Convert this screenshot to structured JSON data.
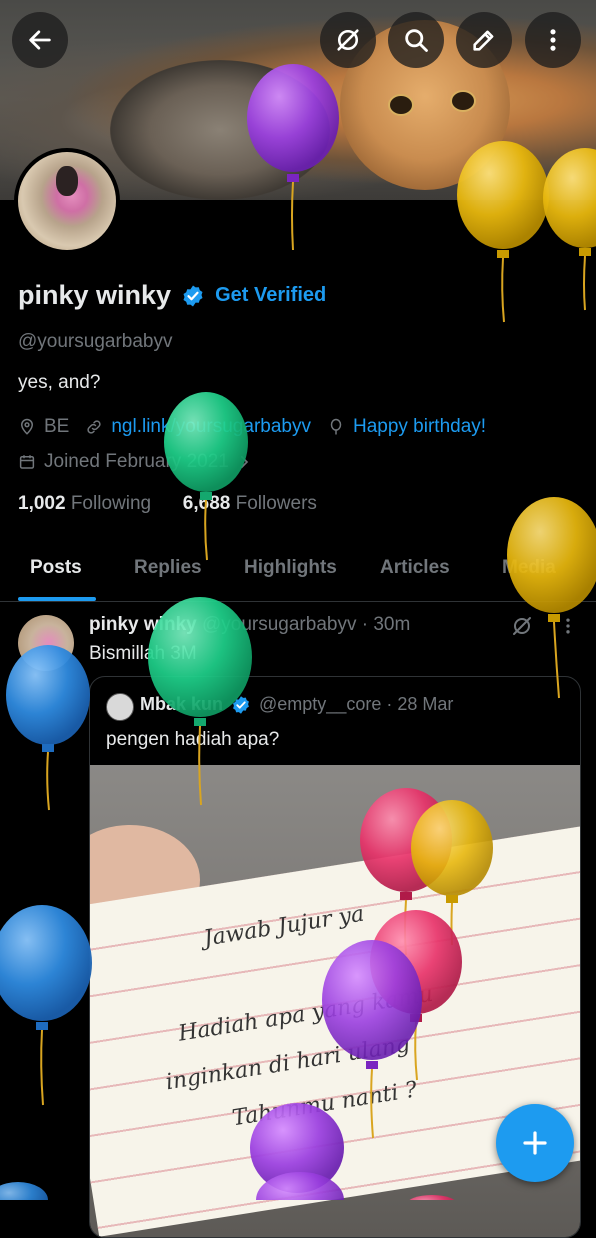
{
  "profile": {
    "name": "pinky winky",
    "get_verified": "Get Verified",
    "handle": "@yoursugarbabyv",
    "bio": "yes, and?",
    "location": "BE",
    "link": "ngl.link/yoursugarbabyv",
    "birthday": "Happy birthday!",
    "joined": "Joined February 2021",
    "following_count": "1,002",
    "following_label": "Following",
    "followers_count": "6,688",
    "followers_label": "Followers"
  },
  "tabs": [
    "Posts",
    "Replies",
    "Highlights",
    "Articles",
    "Media"
  ],
  "post": {
    "author": "pinky winky",
    "handle": "@yoursugarbabyv",
    "time": "· 30m",
    "text": "Bismillah 3M",
    "quote": {
      "author": "Mbak kun",
      "handle": "@empty__core",
      "time": "· 28 Mar",
      "text": "pengen hadiah apa?",
      "note_lines": [
        "Jawab Jujur ya",
        "Hadiah apa yang kamu",
        "inginkan di hari ulang",
        "Tahunmu nanti ?"
      ]
    }
  },
  "icons": {
    "back": "arrow-left-icon",
    "grok": "grok-icon",
    "search": "search-icon",
    "edit": "edit-icon",
    "more": "more-vertical-icon",
    "compose": "plus-icon"
  },
  "colors": {
    "accent": "#1d9bf0",
    "balloon_purple": "#9b3fe0",
    "balloon_yellow": "#e8b80e",
    "balloon_green": "#1fd08a",
    "balloon_blue": "#2f8be0",
    "balloon_pink": "#e8336a"
  }
}
